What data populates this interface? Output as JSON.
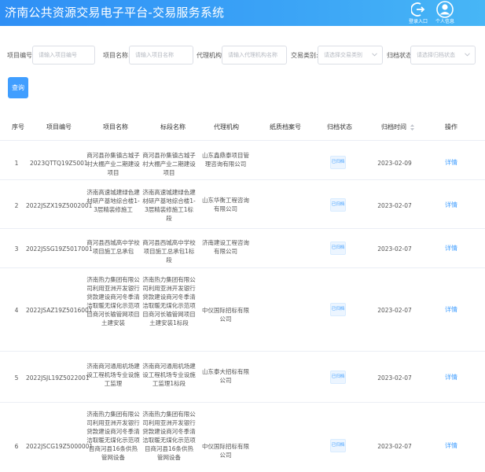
{
  "header": {
    "title": "济南公共资源交易电子平台-交易服务系统",
    "logout_label": "登录入口",
    "profile_label": "个人信息"
  },
  "filters": {
    "project_no": {
      "label": "项目编号:",
      "placeholder": "请输入项目编号"
    },
    "project_name": {
      "label": "项目名称:",
      "placeholder": "请输入项目名称"
    },
    "agency": {
      "label": "代理机构:",
      "placeholder": "请输入代理机构名称"
    },
    "trade_type": {
      "label": "交易类别:",
      "placeholder": "请选择交易类别"
    },
    "archive_status": {
      "label": "归档状态:",
      "placeholder": "请选择归档状态"
    },
    "query_button": "查询"
  },
  "table": {
    "columns": [
      "序号",
      "项目编号",
      "项目名称",
      "标段名称",
      "代理机构",
      "纸质档案号",
      "归档状态",
      "归档时间",
      "操作"
    ],
    "rows": [
      {
        "index": "1",
        "project_no": "2023QTTQ19Z5001",
        "project_name": "商河县孙集镇古城子村大棚产业二期建设项目",
        "section_name": "商河县孙集镇古城子村大棚产业二期建设项目",
        "agency": "山东鑫鼎泰项目管理咨询有限公司",
        "paper_no": "",
        "status": "已归档",
        "date": "2023-02-09",
        "action": "详情"
      },
      {
        "index": "2",
        "project_no": "2022JSZX19Z5002001",
        "project_name": "济南高速城建绿色建材研产基地综合楼1-3层精装修施工",
        "section_name": "济南高速城建绿色建材研产基地综合楼1-3层精装修施工1标段",
        "agency": "山东华衡工程咨询有限公司",
        "paper_no": "",
        "status": "已归档",
        "date": "2023-02-07",
        "action": "详情"
      },
      {
        "index": "3",
        "project_no": "2022JSSG19Z5017001",
        "project_name": "商河县西城高中学校项目施工总承包",
        "section_name": "商河县西城高中学校项目施工总承包1标段",
        "agency": "济南建设工程咨询有限公司",
        "paper_no": "",
        "status": "已归档",
        "date": "2023-02-07",
        "action": "详情"
      },
      {
        "index": "4",
        "project_no": "2022JSAZ19Z5016001",
        "project_name": "济南热力集团有限公司利用亚洲开发银行贷款建设商河冬季清洁取暖无煤化示范项目商河长输管网项目土建安装",
        "section_name": "济南热力集团有限公司利用亚洲开发银行贷款建设商河冬季清洁取暖无煤化示范项目商河长输管网项目土建安装1标段",
        "agency": "中仪国际招标有限公司",
        "paper_no": "",
        "status": "已归档",
        "date": "2023-02-07",
        "action": "详情"
      },
      {
        "index": "5",
        "project_no": "2022JSJL19Z5022001",
        "project_name": "济南商河通用机场建设工程机场专业设施工监理",
        "section_name": "济南商河通用机场建设工程机场专业设施工监理1标段",
        "agency": "山东泰大招标有限公司",
        "paper_no": "",
        "status": "已归档",
        "date": "2023-02-07",
        "action": "详情"
      },
      {
        "index": "6",
        "project_no": "2022JSCG19Z5000001",
        "project_name": "济南热力集团有限公司利用亚洲开发银行贷款建设商河冬季清洁取暖无煤化示范项目商河县16条供热管网设备",
        "section_name": "济南热力集团有限公司利用亚洲开发银行贷款建设商河冬季清洁取暖无煤化示范项目商河县16条供热管网设备",
        "agency": "中仪国际招标有限公司",
        "paper_no": "",
        "status": "已归档",
        "date": "2023-02-07",
        "action": "详情"
      }
    ]
  },
  "colors": {
    "header": "#2f8ff5",
    "accent": "#409eff"
  },
  "icons": {
    "logout": "logout-icon",
    "profile": "user-icon",
    "sort": "sort-icon",
    "dropdown": "chevron-down-icon"
  }
}
